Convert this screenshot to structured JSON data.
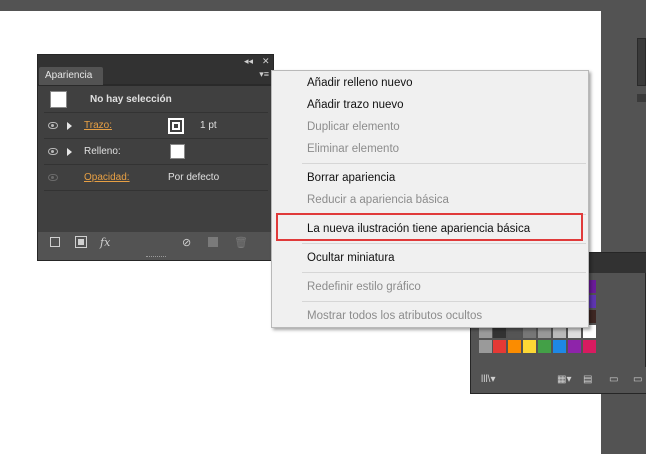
{
  "panel": {
    "tab_label": "Apariencia",
    "collapse_glyph": "◂◂",
    "close_glyph": "✕",
    "menu_glyph": "▾≡",
    "selection_label": "No hay selección",
    "rows": [
      {
        "label": "Trazo:",
        "value": "1 pt"
      },
      {
        "label": "Relleno:",
        "value": ""
      },
      {
        "label": "Opacidad:",
        "value": "Por defecto"
      }
    ],
    "footer_icons": [
      "add-new-stroke-icon",
      "add-new-fill-icon",
      "add-effect-icon",
      "clear-appearance-icon",
      "duplicate-item-icon",
      "delete-item-icon"
    ],
    "fx_label": "fx"
  },
  "menu": {
    "items": [
      {
        "label": "Añadir relleno nuevo",
        "enabled": true
      },
      {
        "label": "Añadir trazo nuevo",
        "enabled": true
      },
      {
        "label": "Duplicar elemento",
        "enabled": false
      },
      {
        "label": "Eliminar elemento",
        "enabled": false
      },
      {
        "label": "Borrar apariencia",
        "enabled": true
      },
      {
        "label": "Reducir a apariencia básica",
        "enabled": false
      },
      {
        "label": "La nueva ilustración tiene apariencia básica",
        "enabled": true
      },
      {
        "label": "Ocultar miniatura",
        "enabled": true
      },
      {
        "label": "Redefinir estilo gráfico",
        "enabled": false
      },
      {
        "label": "Mostrar todos los atributos ocultos",
        "enabled": false
      }
    ]
  },
  "colors": {
    "accent_link": "#e8a044",
    "highlight_border": "#e03a3a",
    "panel_bg": "#535353",
    "menu_bg": "#f0f0f0"
  },
  "swatches": {
    "row1": [
      "#8a2be2",
      "#3b3bd9",
      "#1f4fa0",
      "#d81b60",
      "#e53935",
      "#7b1fa2",
      "#6a1b9a"
    ],
    "row2": [
      "#26a69a",
      "#1e88e5",
      "#0d47a1",
      "#303f9f",
      "#c62828",
      "#8e24aa",
      "#5e35b1"
    ],
    "row3": [
      "#c49a6c",
      "#a47148",
      "#8d5b34",
      "#6d4c41",
      "#5d4037",
      "#4e342e",
      "#3e2723"
    ],
    "row4": [
      "#333333",
      "#555555",
      "#777777",
      "#999999",
      "#bbbbbb",
      "#dddddd",
      "#ffffff"
    ],
    "row5": [
      "#e53935",
      "#fb8c00",
      "#fdd835",
      "#43a047",
      "#1e88e5",
      "#8e24aa",
      "#d81b60"
    ]
  }
}
